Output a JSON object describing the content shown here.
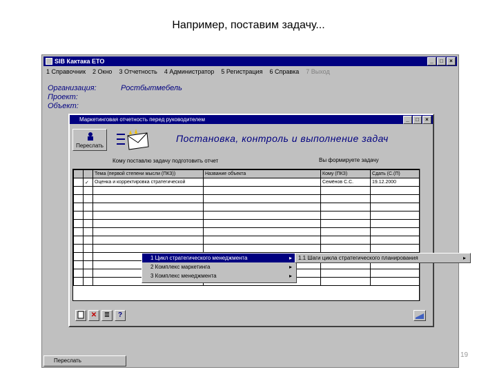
{
  "slide": {
    "title": "Например, поставим задачу...",
    "page_number": "19"
  },
  "main_window": {
    "title": "SIB Кактака ЕТО",
    "buttons": [
      "_",
      "□",
      "×"
    ],
    "menu": [
      {
        "label": "1 Справочник"
      },
      {
        "label": "2 Окно"
      },
      {
        "label": "3 Отчетность"
      },
      {
        "label": "4 Администратор"
      },
      {
        "label": "5 Регистрация"
      },
      {
        "label": "6 Справка"
      },
      {
        "label": "7 Выход",
        "disabled": true
      }
    ],
    "org_label": "Организация:",
    "org_value": "Ростбытмебель",
    "project_label": "Проект:",
    "object_label": "Объект:"
  },
  "inner_window": {
    "title": "Маркетинговая отчетность перед руководителем",
    "buttons": [
      "_",
      "□",
      "×"
    ],
    "forward_label": "Переслать",
    "header_title": "Постановка, контроль и выполнение задач",
    "tip_left": "Кому поставлю задачу подготовить отчет",
    "tip_right": "Вы формируете задачу",
    "columns": [
      "",
      "",
      "Тема (первой степени мысли (ПКЗ))",
      "Название объекта",
      "Кому (ПКЗ)",
      "Сдать (С.(П)"
    ],
    "rows": [
      {
        "col1": "",
        "col2": "✓",
        "col3": "Оценка и корректировка стратегической",
        "col4": "",
        "col5": "Семёнов С.С.",
        "col6": "19.12.2000"
      },
      {
        "col1": "",
        "col2": "",
        "col3": "",
        "col4": "",
        "col5": "",
        "col6": ""
      }
    ],
    "empty_rows": 11,
    "context_menu": [
      {
        "label": "1 Цикл стратегического менеджмента",
        "arrow": "▸",
        "selected": true
      },
      {
        "label": "2 Комплекс маркетинга",
        "arrow": "▸"
      },
      {
        "label": "3 Комплекс менеджмента",
        "arrow": "▸"
      }
    ],
    "submenu_label": "1.1 Шаги цикла стратегического планирования",
    "submenu_arrow": "▸",
    "tool_labels": [
      "",
      "✕",
      "≣",
      "?"
    ]
  },
  "taskbar": {
    "label": "Переслать"
  },
  "colors": {
    "titlebar": "#000080",
    "face": "#c0c0c0",
    "accent_text": "#000080"
  }
}
